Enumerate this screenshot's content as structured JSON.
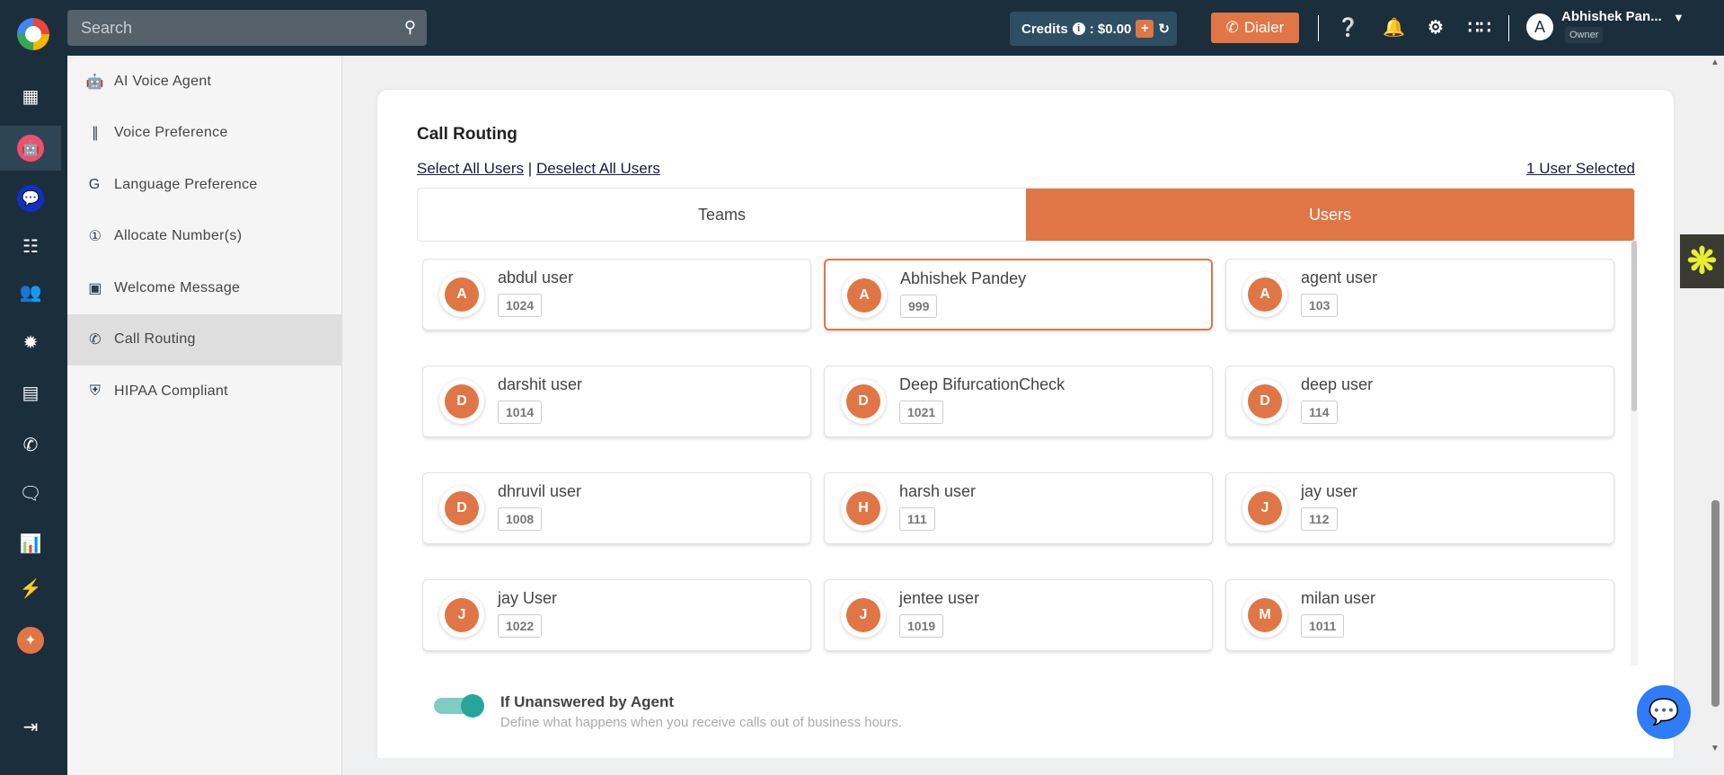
{
  "topbar": {
    "search_placeholder": "Search",
    "credits_label": "Credits",
    "credits_value": ": $0.00",
    "dialer_label": "Dialer",
    "user_name": "Abhishek Pan...",
    "user_role": "Owner",
    "user_initial": "A"
  },
  "rail": {
    "icons": [
      "dashboard-icon",
      "ai-agent-icon",
      "chat-bot-icon",
      "dialpad-icon",
      "contacts-icon",
      "integrations-icon",
      "workflow-icon",
      "call-transfer-icon",
      "message-icon",
      "reports-icon",
      "power-dialer-icon",
      "ai-sparkle-icon",
      "logout-icon"
    ]
  },
  "sidebar": {
    "items": [
      {
        "label": "AI Voice Agent",
        "icon": "robot-icon"
      },
      {
        "label": "Voice Preference",
        "icon": "voice-wave-icon"
      },
      {
        "label": "Language Preference",
        "icon": "translate-icon"
      },
      {
        "label": "Allocate Number(s)",
        "icon": "number-icon"
      },
      {
        "label": "Welcome Message",
        "icon": "welcome-icon"
      },
      {
        "label": "Call Routing",
        "icon": "phone-icon",
        "active": true
      },
      {
        "label": "HIPAA Compliant",
        "icon": "shield-icon"
      }
    ]
  },
  "main": {
    "title": "Call Routing",
    "select_all": "Select All Users",
    "separator": "|",
    "deselect_all": "Deselect All Users",
    "selected_count": "1 User Selected",
    "tabs": [
      {
        "label": "Teams",
        "active": false
      },
      {
        "label": "Users",
        "active": true
      }
    ],
    "users": [
      {
        "initial": "A",
        "name": "abdul user",
        "ext": "1024"
      },
      {
        "initial": "A",
        "name": "Abhishek Pandey",
        "ext": "999",
        "selected": true
      },
      {
        "initial": "A",
        "name": "agent user",
        "ext": "103"
      },
      {
        "initial": "D",
        "name": "darshit user",
        "ext": "1014"
      },
      {
        "initial": "D",
        "name": "Deep BifurcationCheck",
        "ext": "1021"
      },
      {
        "initial": "D",
        "name": "deep user",
        "ext": "114"
      },
      {
        "initial": "D",
        "name": "dhruvil user",
        "ext": "1008"
      },
      {
        "initial": "H",
        "name": "harsh user",
        "ext": "111"
      },
      {
        "initial": "J",
        "name": "jay user",
        "ext": "112"
      },
      {
        "initial": "J",
        "name": "jay User",
        "ext": "1022"
      },
      {
        "initial": "J",
        "name": "jentee user",
        "ext": "1019"
      },
      {
        "initial": "M",
        "name": "milan user",
        "ext": "1011"
      }
    ],
    "unanswered": {
      "title": "If Unanswered by Agent",
      "description": "Define what happens when you receive calls out of business hours.",
      "enabled": true
    }
  },
  "colors": {
    "accent": "#e07645",
    "topbar": "#1b2e3c",
    "toggle": "#26a69a",
    "chat": "#2f7cf6"
  }
}
